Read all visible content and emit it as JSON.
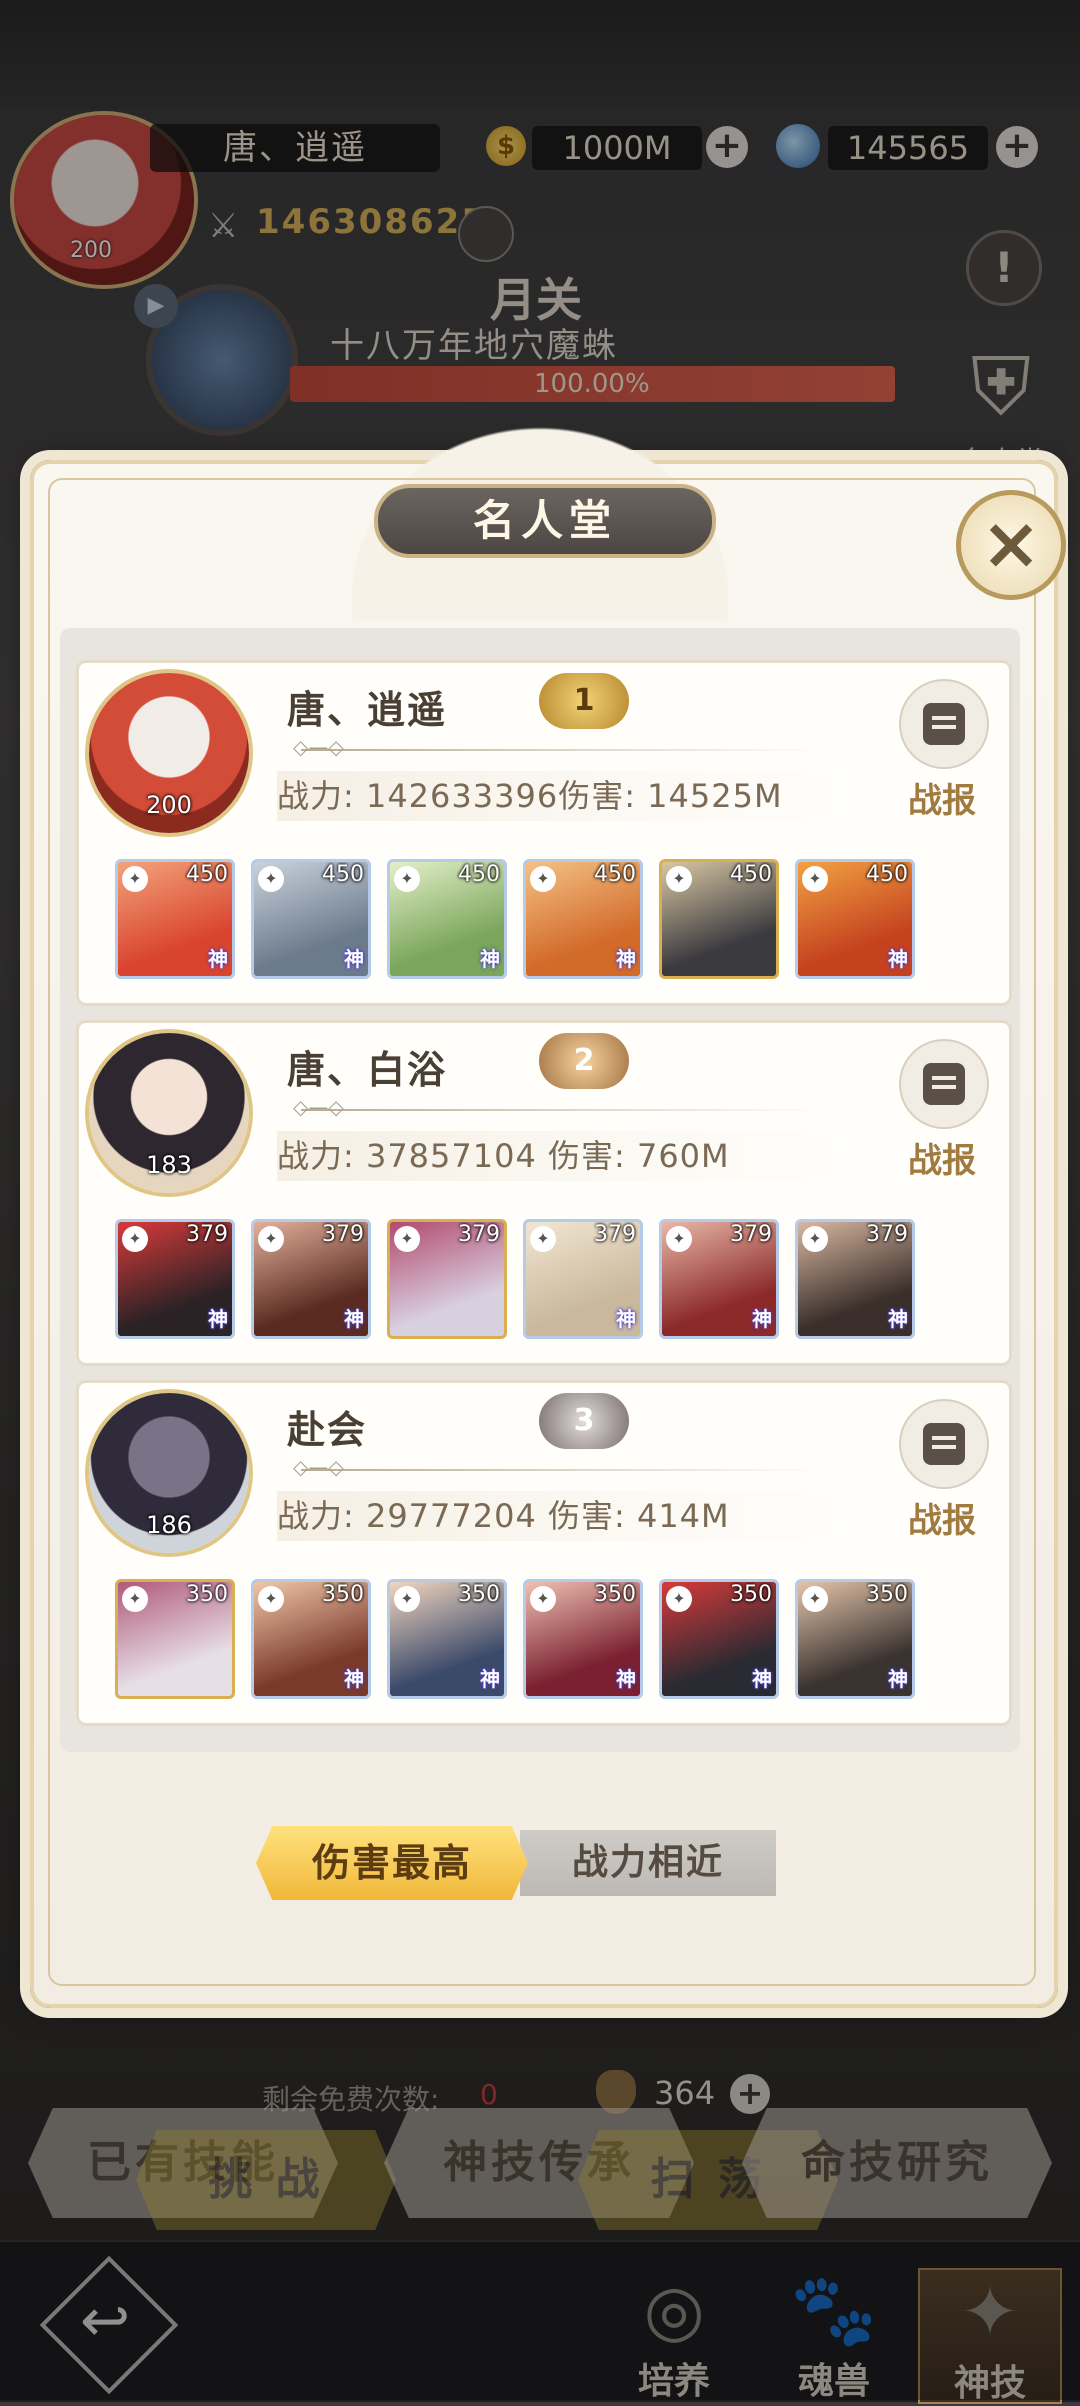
{
  "player": {
    "name": "唐、逍遥",
    "level": "200",
    "power": "146308625"
  },
  "resources": {
    "gold": "1000M",
    "diamond": "145565"
  },
  "stage": {
    "title": "月关",
    "boss": "十八万年地穴魔蛛",
    "progress_text": "100.00%",
    "progress": 1.0
  },
  "side": {
    "fame_label": "名人堂"
  },
  "bottom": {
    "free_label": "剩余免费次数:",
    "free_count": "0",
    "tickets": "364",
    "buttons": [
      "已有技能",
      "神技传承",
      "命技研究"
    ],
    "buttons2": [
      "挑 战",
      "扫 荡"
    ],
    "nav": [
      "培养",
      "魂兽",
      "神技"
    ]
  },
  "modal": {
    "title": "名人堂",
    "report_label": "战报",
    "tabs": {
      "active": "伤害最高",
      "inactive": "战力相近"
    },
    "entries": [
      {
        "rank": "1",
        "name": "唐、逍遥",
        "level": "200",
        "stats": "战力: 142633396伤害: 14525M",
        "heroes": [
          {
            "level": "450",
            "colors": [
              "#d9442f",
              "#f2a37a"
            ],
            "god": "神"
          },
          {
            "level": "450",
            "colors": [
              "#6c7b8c",
              "#c9d2dd"
            ],
            "god": "神"
          },
          {
            "level": "450",
            "colors": [
              "#7aa55a",
              "#e3efc9"
            ],
            "god": "神"
          },
          {
            "level": "450",
            "colors": [
              "#d26a2a",
              "#f4c184"
            ],
            "god": "神"
          },
          {
            "level": "450",
            "colors": [
              "#3b3a3f",
              "#d8c7a3"
            ],
            "god": ""
          },
          {
            "level": "450",
            "colors": [
              "#c5421f",
              "#f1a142"
            ],
            "god": "神"
          }
        ]
      },
      {
        "rank": "2",
        "name": "唐、白浴",
        "level": "183",
        "stats": "战力: 37857104 伤害: 760M",
        "heroes": [
          {
            "level": "379",
            "colors": [
              "#2a2225",
              "#d83a3a"
            ],
            "god": "神"
          },
          {
            "level": "379",
            "colors": [
              "#5b2b22",
              "#e2b09a"
            ],
            "god": "神"
          },
          {
            "level": "379",
            "colors": [
              "#d8cfe0",
              "#b24a6e"
            ],
            "god": ""
          },
          {
            "level": "379",
            "colors": [
              "#c9b89c",
              "#f2e6d2"
            ],
            "god": "神"
          },
          {
            "level": "379",
            "colors": [
              "#8c2a2a",
              "#e8b7a6"
            ],
            "god": "神"
          },
          {
            "level": "379",
            "colors": [
              "#3a2f2b",
              "#d8b7a0"
            ],
            "god": "神"
          }
        ]
      },
      {
        "rank": "3",
        "name": "赴会",
        "level": "186",
        "stats": "战力: 29777204 伤害: 414M",
        "heroes": [
          {
            "level": "350",
            "colors": [
              "#e7dfe8",
              "#b05a7a"
            ],
            "god": ""
          },
          {
            "level": "350",
            "colors": [
              "#7a3a2a",
              "#efc6a8"
            ],
            "god": "神"
          },
          {
            "level": "350",
            "colors": [
              "#3c4a6a",
              "#f1d6bf"
            ],
            "god": "神"
          },
          {
            "level": "350",
            "colors": [
              "#7a2030",
              "#eec0b2"
            ],
            "god": "神"
          },
          {
            "level": "350",
            "colors": [
              "#2a2a32",
              "#d73a3a"
            ],
            "god": "神"
          },
          {
            "level": "350",
            "colors": [
              "#3a3330",
              "#e3c4aa"
            ],
            "god": "神"
          }
        ]
      }
    ]
  }
}
